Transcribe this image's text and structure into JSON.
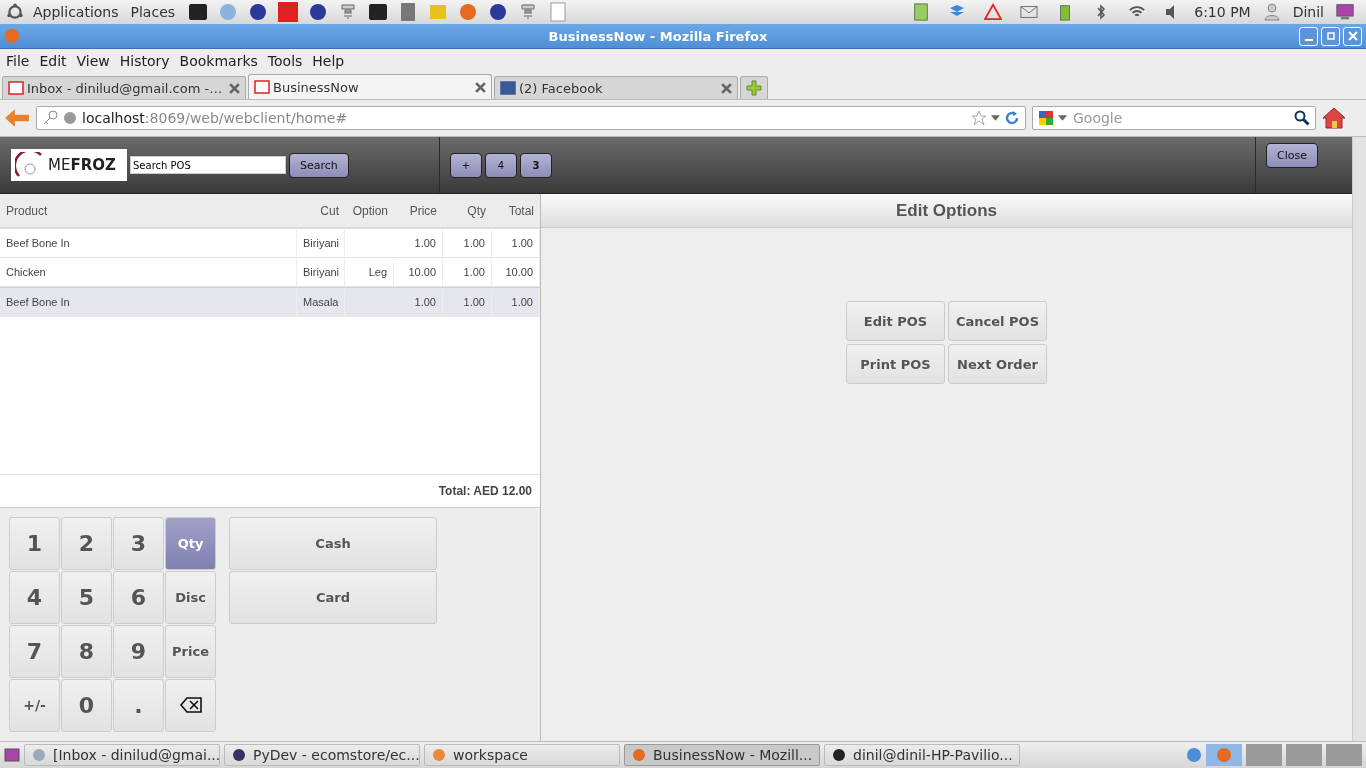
{
  "top_panel": {
    "menus": [
      "Applications",
      "Places"
    ],
    "clock": "6:10 PM",
    "user": "Dinil"
  },
  "window": {
    "title": "BusinessNow - Mozilla Firefox"
  },
  "menu_bar": [
    "File",
    "Edit",
    "View",
    "History",
    "Bookmarks",
    "Tools",
    "Help"
  ],
  "browser_tabs": [
    {
      "label": "Inbox - dinilud@gmail.com -…",
      "selected": false
    },
    {
      "label": "BusinessNow",
      "selected": true
    },
    {
      "label": "(2) Facebook",
      "selected": false
    }
  ],
  "address_bar": {
    "host": "localhost",
    "path": ":8069/web/webclient/home#"
  },
  "search_bar": {
    "placeholder": "Google"
  },
  "pos": {
    "logo": "ME**FROZ**",
    "search": {
      "value": "Search POS",
      "button": "Search"
    },
    "order_tabs": [
      {
        "label": "+",
        "selected": false
      },
      {
        "label": "4",
        "selected": false
      },
      {
        "label": "3",
        "selected": true
      }
    ],
    "close_button": "Close",
    "table": {
      "columns": [
        "Product",
        "Cut",
        "Option",
        "Price",
        "Qty",
        "Total"
      ],
      "rows": [
        {
          "cells": [
            "Beef Bone In",
            "Biriyani",
            "",
            "1.00",
            "1.00",
            "1.00"
          ],
          "selected": false
        },
        {
          "cells": [
            "Chicken",
            "Biriyani",
            "Leg",
            "10.00",
            "1.00",
            "10.00"
          ],
          "selected": false
        },
        {
          "cells": [
            "Beef Bone In",
            "Masala",
            "",
            "1.00",
            "1.00",
            "1.00"
          ],
          "selected": true
        }
      ]
    },
    "total": "Total: AED 12.00",
    "keypad": [
      {
        "kind": "digit",
        "label": "1",
        "selected": false
      },
      {
        "kind": "digit",
        "label": "2",
        "selected": false
      },
      {
        "kind": "digit",
        "label": "3",
        "selected": false
      },
      {
        "kind": "mode",
        "label": "Qty",
        "selected": true
      },
      {
        "kind": "digit",
        "label": "4",
        "selected": false
      },
      {
        "kind": "digit",
        "label": "5",
        "selected": false
      },
      {
        "kind": "digit",
        "label": "6",
        "selected": false
      },
      {
        "kind": "mode",
        "label": "Disc",
        "selected": false
      },
      {
        "kind": "digit",
        "label": "7",
        "selected": false
      },
      {
        "kind": "digit",
        "label": "8",
        "selected": false
      },
      {
        "kind": "digit",
        "label": "9",
        "selected": false
      },
      {
        "kind": "mode",
        "label": "Price",
        "selected": false
      },
      {
        "kind": "sign",
        "label": "+/-",
        "selected": false
      },
      {
        "kind": "digit",
        "label": "0",
        "selected": false
      },
      {
        "kind": "digit",
        "label": ".",
        "selected": false
      },
      {
        "kind": "backspace",
        "selected": false
      }
    ],
    "payment_buttons": [
      "Cash",
      "Card"
    ],
    "edit_options": {
      "title": "Edit Options",
      "buttons": [
        "Edit POS",
        "Cancel POS",
        "Print POS",
        "Next Order"
      ]
    }
  },
  "taskbar": [
    {
      "label": "[Inbox - dinilud@gmai...",
      "selected": false
    },
    {
      "label": "PyDev - ecomstore/ec...",
      "selected": false
    },
    {
      "label": "workspace",
      "selected": false
    },
    {
      "label": "BusinessNow - Mozill...",
      "selected": true
    },
    {
      "label": "dinil@dinil-HP-Pavilio...",
      "selected": false
    }
  ]
}
